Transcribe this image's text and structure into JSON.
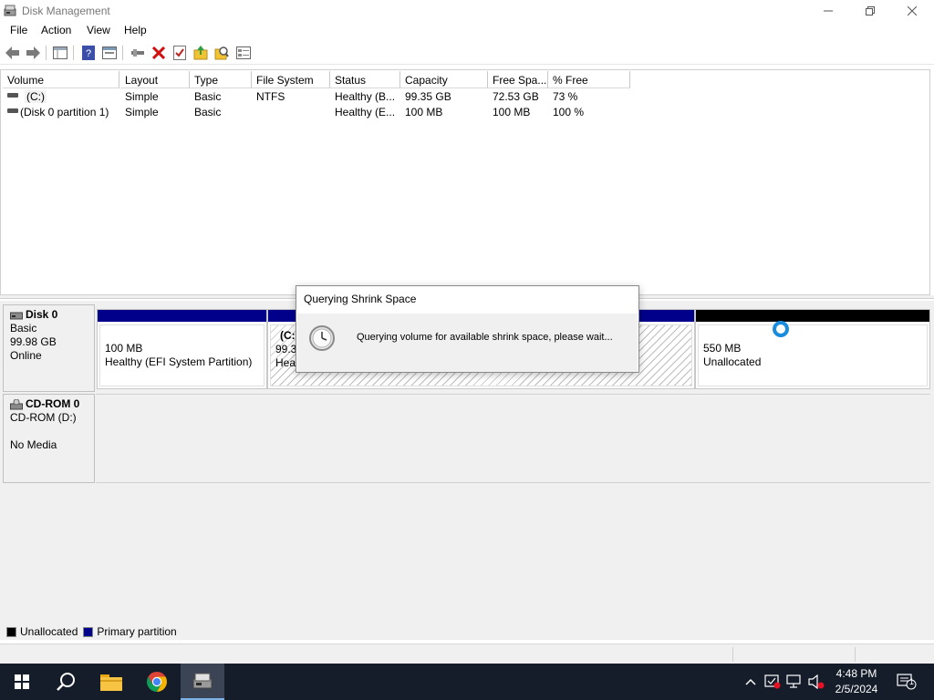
{
  "window": {
    "title": "Disk Management",
    "controls": {
      "minimize": "minimize",
      "maximize": "maximize",
      "close": "close"
    }
  },
  "menu": {
    "items": [
      "File",
      "Action",
      "View",
      "Help"
    ]
  },
  "toolbar": {
    "buttons": [
      "back-icon",
      "forward-icon",
      "console-tree-icon",
      "help-icon",
      "properties-icon",
      "connect-icon",
      "delete-icon",
      "checklist-icon",
      "import-icon",
      "search-icon",
      "settings-list-icon"
    ]
  },
  "volume_list": {
    "columns": [
      "Volume",
      "Layout",
      "Type",
      "File System",
      "Status",
      "Capacity",
      "Free Spa...",
      "% Free"
    ],
    "rows": [
      {
        "volume": "(C:)",
        "layout": "Simple",
        "type": "Basic",
        "file_system": "NTFS",
        "status": "Healthy (B...",
        "capacity": "99.35 GB",
        "free_space": "72.53 GB",
        "percent_free": "73 %"
      },
      {
        "volume": "(Disk 0 partition 1)",
        "layout": "Simple",
        "type": "Basic",
        "file_system": "",
        "status": "Healthy (E...",
        "capacity": "100 MB",
        "free_space": "100 MB",
        "percent_free": "100 %"
      }
    ]
  },
  "disks": [
    {
      "name": "Disk 0",
      "type": "Basic",
      "size": "99.98 GB",
      "state": "Online",
      "partitions": [
        {
          "line1": "100 MB",
          "line2": "Healthy (EFI System Partition)",
          "kind": "primary"
        },
        {
          "line0": "(C:",
          "line1": "99.3",
          "line2": "Heal",
          "kind": "primary"
        },
        {
          "line1": "550 MB",
          "line2": "Unallocated",
          "kind": "unallocated"
        }
      ]
    },
    {
      "name": "CD-ROM 0",
      "type": "CD-ROM (D:)",
      "state": "No Media"
    }
  ],
  "legend": [
    {
      "label": "Unallocated",
      "color": "#000000"
    },
    {
      "label": "Primary partition",
      "color": "#00008b"
    }
  ],
  "dialog": {
    "title": "Querying Shrink Space",
    "message": "Querying volume for available shrink space, please wait...",
    "icon": "clock-icon"
  },
  "taskbar": {
    "apps": [
      "start-icon",
      "search-icon",
      "file-explorer-icon",
      "chrome-icon",
      "disk-management-icon"
    ],
    "tray": [
      "chevron-up-icon",
      "security-icon",
      "network-icon",
      "volume-muted-icon"
    ],
    "time": "4:48 PM",
    "date": "2/5/2024",
    "notification_count": "1"
  },
  "colors": {
    "primary_partition": "#00008b",
    "unallocated": "#000000",
    "accent_spinner": "#1a8cde",
    "taskbar": "#151d2a"
  }
}
